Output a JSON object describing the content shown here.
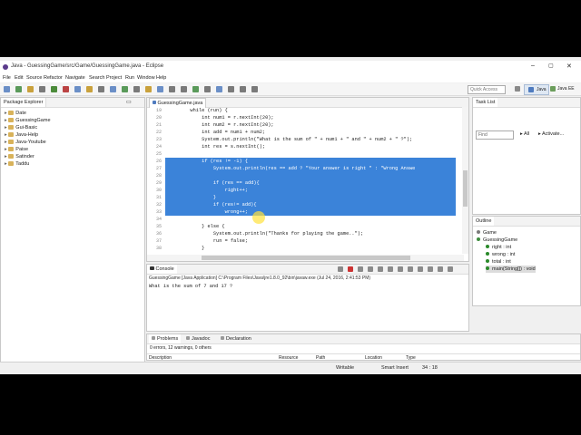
{
  "window": {
    "title": "Java - GuessingGame/src/Game/GuessingGame.java - Eclipse"
  },
  "menu": [
    "File",
    "Edit",
    "Source",
    "Refactor",
    "Navigate",
    "Search",
    "Project",
    "Run",
    "Window",
    "Help"
  ],
  "toolbar": {
    "quick_access": "Quick Access",
    "perspective_java": "Java",
    "perspective_javaee": "Java EE"
  },
  "package_explorer": {
    "title": "Package Explorer",
    "items": [
      "Date",
      "GuessingGame",
      "Gui-Basic",
      "Java-Help",
      "Java-Youtube",
      "Paise",
      "Satinder",
      "Taddu"
    ]
  },
  "editor": {
    "tab": "GuessingGame.java",
    "lines": [
      {
        "n": "19",
        "code": "        while (run) {"
      },
      {
        "n": "20",
        "code": "            int num1 = r.nextInt(20);"
      },
      {
        "n": "21",
        "code": "            int num2 = r.nextInt(20);"
      },
      {
        "n": "22",
        "code": "            int add = num1 + num2;"
      },
      {
        "n": "23",
        "code": "            System.out.println(\"What is the sum of \" + num1 + \" and \" + num2 + \" ?\");"
      },
      {
        "n": "24",
        "code": "            int res = s.nextInt();"
      },
      {
        "n": "25",
        "code": ""
      },
      {
        "n": "26",
        "code": "            if (res != -1) {"
      },
      {
        "n": "27",
        "code": "                System.out.println(res == add ? \"Your answer is right \" : \"Wrong Answe"
      },
      {
        "n": "28",
        "code": ""
      },
      {
        "n": "29",
        "code": "                if (res == add){"
      },
      {
        "n": "30",
        "code": "                    right++;"
      },
      {
        "n": "31",
        "code": "                }"
      },
      {
        "n": "32",
        "code": "                if (res!= add){"
      },
      {
        "n": "33",
        "code": "                    wrong++;"
      },
      {
        "n": "34",
        "code": "                }"
      },
      {
        "n": "35",
        "code": "            } else {"
      },
      {
        "n": "36",
        "code": "                System.out.println(\"Thanks for playing the game..\");"
      },
      {
        "n": "37",
        "code": "                run = false;"
      },
      {
        "n": "38",
        "code": "            }"
      }
    ]
  },
  "task_list": {
    "title": "Task List",
    "find_placeholder": "Find",
    "all": "All",
    "activate": "Activate..."
  },
  "outline": {
    "title": "Outline",
    "items": [
      "Game",
      "GuessingGame",
      "right : int",
      "wrong : int",
      "total : int",
      "main(String[]) : void"
    ]
  },
  "console": {
    "title": "Console",
    "header": "GuessingGame [Java Application] C:\\Program Files\\Java\\jre1.8.0_92\\bin\\javaw.exe (Jul 24, 2016, 2:41:53 PM)",
    "output": "What is the sum of 7 and 17 ?"
  },
  "problems": {
    "tabs": [
      "Problems",
      "Javadoc",
      "Declaration"
    ],
    "summary": "0 errors, 12 warnings, 0 others",
    "columns": [
      "Description",
      "Resource",
      "Path",
      "Location",
      "Type"
    ]
  },
  "status": {
    "writable": "Writable",
    "insert": "Smart Insert",
    "position": "34 : 18"
  }
}
